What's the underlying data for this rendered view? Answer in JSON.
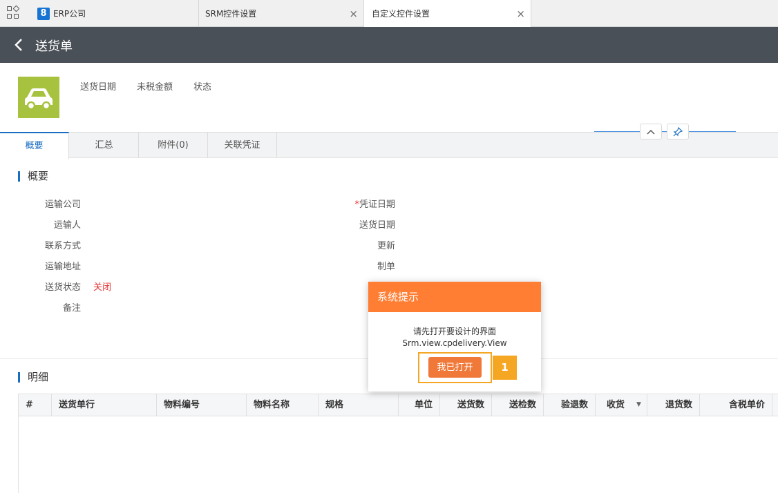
{
  "tabs": [
    {
      "label": "ERP公司",
      "logo": "8"
    },
    {
      "label": "SRM控件设置",
      "close": "×"
    },
    {
      "label": "自定义控件设置",
      "close": "×"
    }
  ],
  "header": {
    "back": "‹",
    "title": "送货单"
  },
  "summary_labels": [
    "送货日期",
    "未税金额",
    "状态"
  ],
  "subtabs": [
    "概要",
    "汇总",
    "附件(0)",
    "关联凭证"
  ],
  "controls": {
    "collapse": "^",
    "pin": "⚲"
  },
  "overview": {
    "title": "概要",
    "left_fields": [
      {
        "label": "运输公司",
        "value": ""
      },
      {
        "label": "运输人",
        "value": ""
      },
      {
        "label": "联系方式",
        "value": ""
      },
      {
        "label": "运输地址",
        "value": ""
      },
      {
        "label": "送货状态",
        "value": "关闭"
      },
      {
        "label": "备注",
        "value": ""
      }
    ],
    "right_fields": [
      {
        "required_mark": "*",
        "label": "凭证日期"
      },
      {
        "required_mark": "",
        "label": "送货日期"
      },
      {
        "required_mark": "",
        "label": "更新"
      },
      {
        "required_mark": "",
        "label": "制单"
      }
    ]
  },
  "detail": {
    "title": "明细",
    "columns": [
      "#",
      "送货单行",
      "物料编号",
      "物料名称",
      "规格",
      "单位",
      "送货数",
      "送检数",
      "验退数",
      "收货",
      "退货数",
      "含税单价"
    ],
    "dropdown": "▼"
  },
  "dialog": {
    "title": "系统提示",
    "message_line1": "请先打开要设计的界面",
    "message_line2": "Srm.view.cpdelivery.View",
    "button": "我已打开",
    "step": "1"
  },
  "colors": {
    "accent": "#1a6ec0",
    "dialog_header": "#ff7e33",
    "dialog_button": "#f0793a",
    "highlight": "#f5a623",
    "titlebar": "#4a5057",
    "car_icon_bg": "#a6c23f",
    "status_closed": "#e33333"
  }
}
